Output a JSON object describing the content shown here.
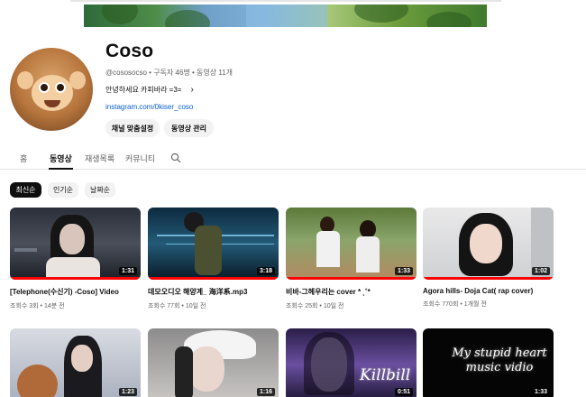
{
  "channel": {
    "name": "Coso",
    "handle": "@cososocso",
    "subscribers": "구독자 46명",
    "video_count": "동영상 11개",
    "description": "안녕하세요 카피바라 =3=",
    "link": "instagram.com/0kiser_coso",
    "customize_button": "채널 맞춤설정",
    "manage_button": "동영상 관리"
  },
  "tabs": [
    {
      "label": "홈",
      "active": false
    },
    {
      "label": "동영상",
      "active": true
    },
    {
      "label": "재생목록",
      "active": false
    },
    {
      "label": "커뮤니티",
      "active": false
    }
  ],
  "chips": [
    {
      "label": "최신순",
      "selected": true
    },
    {
      "label": "인기순",
      "selected": false
    },
    {
      "label": "날짜순",
      "selected": false
    }
  ],
  "videos": [
    {
      "title": "[Telephone(수신기) -Coso] Video",
      "meta": "조회수 3회 • 14분 전",
      "duration": "1:31"
    },
    {
      "title": "데모오디오 해양계_ 海洋系.mp3",
      "meta": "조회수 77회 • 10일 전",
      "duration": "3:18"
    },
    {
      "title": "비바-그헤우리는 cover * ˛˚*",
      "meta": "조회수 25회 • 10일 전",
      "duration": "1:33"
    },
    {
      "title": "Agora hills- Doja Cat( rap cover)",
      "meta": "조회수 770회 • 1개월 전",
      "duration": "1:02"
    },
    {
      "title": "",
      "meta": "",
      "duration": "1:23"
    },
    {
      "title": "",
      "meta": "",
      "duration": "1:16"
    },
    {
      "title": "",
      "meta": "",
      "duration": "0:51",
      "overlay_text": "Killbill"
    },
    {
      "title": "",
      "meta": "",
      "duration": "1:33",
      "overlay_text": "My stupid heart music vidio"
    }
  ],
  "colors": {
    "accent_red": "#ff0000",
    "link_blue": "#065fd4",
    "chip_selected": "#0f0f0f"
  }
}
